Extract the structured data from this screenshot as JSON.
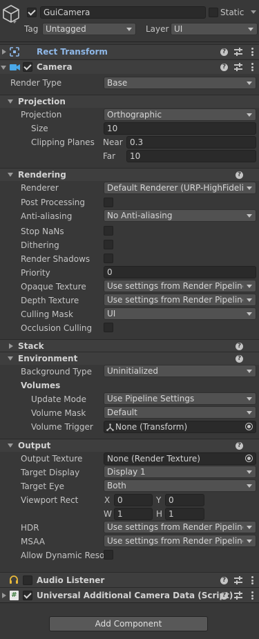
{
  "header": {
    "object_name": "GuiCamera",
    "active": true,
    "static_label": "Static",
    "static_checked": false,
    "tag_label": "Tag",
    "tag_value": "Untagged",
    "layer_label": "Layer",
    "layer_value": "UI"
  },
  "rect_transform": {
    "title": "Rect Transform",
    "icons": [
      "help-icon",
      "presets-icon",
      "kebab-menu-icon"
    ]
  },
  "camera": {
    "title": "Camera",
    "enabled": true,
    "render_type_label": "Render Type",
    "render_type_value": "Base",
    "projection_section": {
      "title": "Projection",
      "projection_label": "Projection",
      "projection_value": "Orthographic",
      "size_label": "Size",
      "size_value": "10",
      "clipping_label": "Clipping Planes",
      "near_label": "Near",
      "near_value": "0.3",
      "far_label": "Far",
      "far_value": "10"
    },
    "rendering_section": {
      "title": "Rendering",
      "renderer_label": "Renderer",
      "renderer_value": "Default Renderer (URP-HighFidelity",
      "post_processing_label": "Post Processing",
      "post_processing": false,
      "anti_aliasing_label": "Anti-aliasing",
      "anti_aliasing_value": "No Anti-aliasing",
      "stop_nans_label": "Stop NaNs",
      "stop_nans": false,
      "dithering_label": "Dithering",
      "dithering": false,
      "render_shadows_label": "Render Shadows",
      "render_shadows": false,
      "priority_label": "Priority",
      "priority_value": "0",
      "opaque_texture_label": "Opaque Texture",
      "opaque_texture_value": "Use settings from Render Pipeline As",
      "depth_texture_label": "Depth Texture",
      "depth_texture_value": "Use settings from Render Pipeline As",
      "culling_mask_label": "Culling Mask",
      "culling_mask_value": "UI",
      "occlusion_culling_label": "Occlusion Culling",
      "occlusion_culling": false
    },
    "stack_section": {
      "title": "Stack"
    },
    "environment_section": {
      "title": "Environment",
      "background_type_label": "Background Type",
      "background_type_value": "Uninitialized",
      "volumes_label": "Volumes",
      "update_mode_label": "Update Mode",
      "update_mode_value": "Use Pipeline Settings",
      "volume_mask_label": "Volume Mask",
      "volume_mask_value": "Default",
      "volume_trigger_label": "Volume Trigger",
      "volume_trigger_value": "None (Transform)"
    },
    "output_section": {
      "title": "Output",
      "output_texture_label": "Output Texture",
      "output_texture_value": "None (Render Texture)",
      "target_display_label": "Target Display",
      "target_display_value": "Display 1",
      "target_eye_label": "Target Eye",
      "target_eye_value": "Both",
      "viewport_rect_label": "Viewport Rect",
      "x_label": "X",
      "x_value": "0",
      "y_label": "Y",
      "y_value": "0",
      "w_label": "W",
      "w_value": "1",
      "h_label": "H",
      "h_value": "1",
      "hdr_label": "HDR",
      "hdr_value": "Use settings from Render Pipeline As",
      "msaa_label": "MSAA",
      "msaa_value": "Use settings from Render Pipeline As",
      "allow_dynamic_label": "Allow Dynamic Resol",
      "allow_dynamic": false
    }
  },
  "audio_listener": {
    "title": "Audio Listener",
    "enabled": false
  },
  "urp_camera_data": {
    "title": "Universal Additional Camera Data (Script)",
    "enabled": true
  },
  "add_component_label": "Add Component",
  "colors": {
    "background": "#383838",
    "header_background": "#3e3e3e",
    "field_background": "#2a2a2a",
    "dropdown_background": "#515151",
    "rect_transform_accent": "#8fb8e8",
    "camera_icon": "#4aa8e8",
    "audio_icon": "#e8b93a",
    "script_icon": "#7fc97f"
  }
}
